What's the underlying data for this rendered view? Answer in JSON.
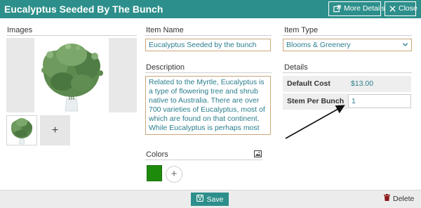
{
  "header": {
    "title": "Eucalyptus Seeded By The Bunch",
    "more_details_label": "More Details",
    "close_label": "Close",
    "more_details_icon": "external-link-icon",
    "close_icon": "close-icon",
    "background_color": "#2d8f8b"
  },
  "images": {
    "section_label": "Images",
    "add_label": "+"
  },
  "item_name": {
    "label": "Item Name",
    "value": "Eucalyptus Seeded by the bunch"
  },
  "item_type": {
    "label": "Item Type",
    "selected": "Blooms & Greenery"
  },
  "description": {
    "label": "Description",
    "value": "Related to the Myrtle, Eucalyptus is a type of flowering tree and shrub native to Australia. There are over 700 varieties of Eucalyptus, most of which are found on that continent. While Eucalyptus is perhaps most well-known for its strong, yet pleasant mint-like scent and its medicinal"
  },
  "details": {
    "section_label": "Details",
    "rows": [
      {
        "key": "Default Cost",
        "value": "$13.00"
      },
      {
        "key": "Stem Per Bunch",
        "value": "1"
      }
    ]
  },
  "colors": {
    "section_label": "Colors",
    "image_icon": "image-icon",
    "add_label": "+",
    "swatches": [
      "#1e8a0c"
    ]
  },
  "footer": {
    "save_label": "Save",
    "save_icon": "save-icon",
    "delete_label": "Delete",
    "delete_icon": "trash-icon",
    "delete_color": "#8b1a1a"
  }
}
